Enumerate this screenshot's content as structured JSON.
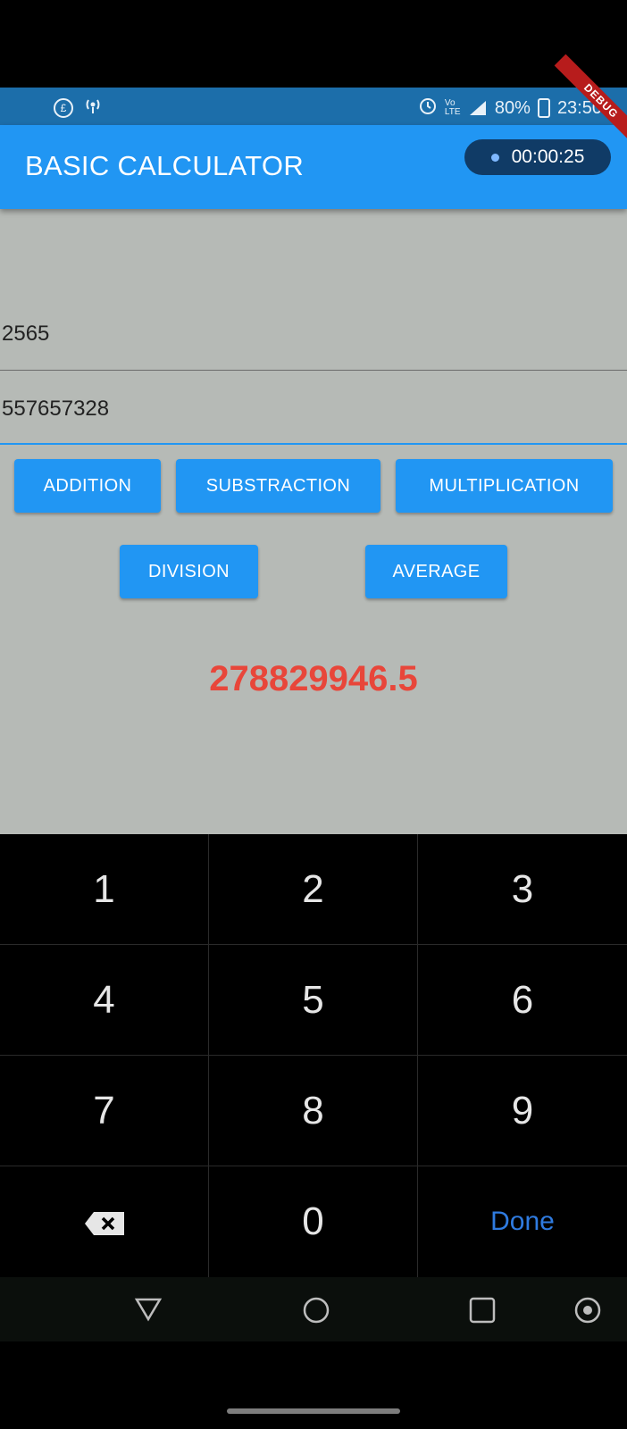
{
  "status_bar": {
    "battery": "80%",
    "time": "23:50",
    "left_icons": [
      "data-saver-icon",
      "hotspot-icon"
    ],
    "right_icons": [
      "alarm-icon",
      "volte-icon",
      "signal-icon",
      "battery-icon"
    ],
    "volte_label": "Vo LTE"
  },
  "app_bar": {
    "title": "BASIC CALCULATOR",
    "recording_timer": "00:00:25",
    "debug_banner": "DEBUG"
  },
  "inputs": {
    "first_value": "2565",
    "second_value": "557657328"
  },
  "operations": {
    "addition": "ADDITION",
    "subtraction": "SUBSTRACTION",
    "multiplication": "MULTIPLICATION",
    "division": "DIVISION",
    "average": "AVERAGE"
  },
  "result": {
    "value": "278829946.5",
    "color": "#e8463a"
  },
  "keypad": {
    "keys": [
      "1",
      "2",
      "3",
      "4",
      "5",
      "6",
      "7",
      "8",
      "9",
      "0"
    ],
    "done_label": "Done",
    "backspace_icon": "backspace-icon"
  },
  "nav_bar": {
    "icons": [
      "back-icon",
      "home-icon",
      "recents-icon",
      "assistant-icon"
    ]
  },
  "colors": {
    "primary": "#2196f3",
    "status_bar": "#1c6eaa",
    "body_background": "#b6bab6",
    "done_key": "#2f7be0"
  }
}
